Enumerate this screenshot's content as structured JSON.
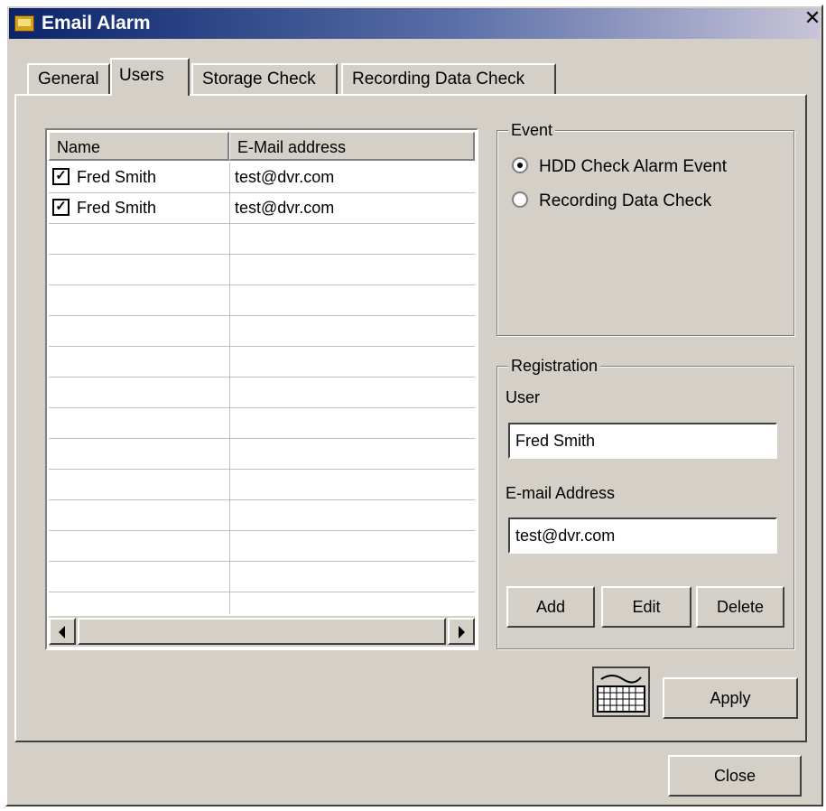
{
  "window": {
    "title": "Email Alarm",
    "close_glyph": "✕"
  },
  "tabs": [
    {
      "label": "General",
      "active": false
    },
    {
      "label": "Users",
      "active": true
    },
    {
      "label": "Storage Check",
      "active": false
    },
    {
      "label": "Recording Data Check",
      "active": false
    }
  ],
  "user_list": {
    "columns": [
      "Name",
      "E-Mail address"
    ],
    "rows": [
      {
        "checked": true,
        "name": "Fred Smith",
        "email": "test@dvr.com"
      },
      {
        "checked": true,
        "name": "Fred Smith",
        "email": "test@dvr.com"
      }
    ]
  },
  "event": {
    "title": "Event",
    "options": [
      {
        "label": "HDD Check Alarm Event",
        "selected": true
      },
      {
        "label": "Recording Data Check",
        "selected": false
      }
    ]
  },
  "registration": {
    "title": "Registration",
    "user_label": "User",
    "user_value": "Fred Smith",
    "email_label": "E-mail Address",
    "email_value": "test@dvr.com",
    "add_label": "Add",
    "edit_label": "Edit",
    "delete_label": "Delete"
  },
  "apply_label": "Apply",
  "close_label": "Close",
  "icons": {
    "keyboard": "keyboard-icon",
    "app": "app-icon"
  },
  "colors": {
    "face": "#d4d0c8",
    "title_start": "#0a246a",
    "title_end": "#c8c4d8"
  }
}
